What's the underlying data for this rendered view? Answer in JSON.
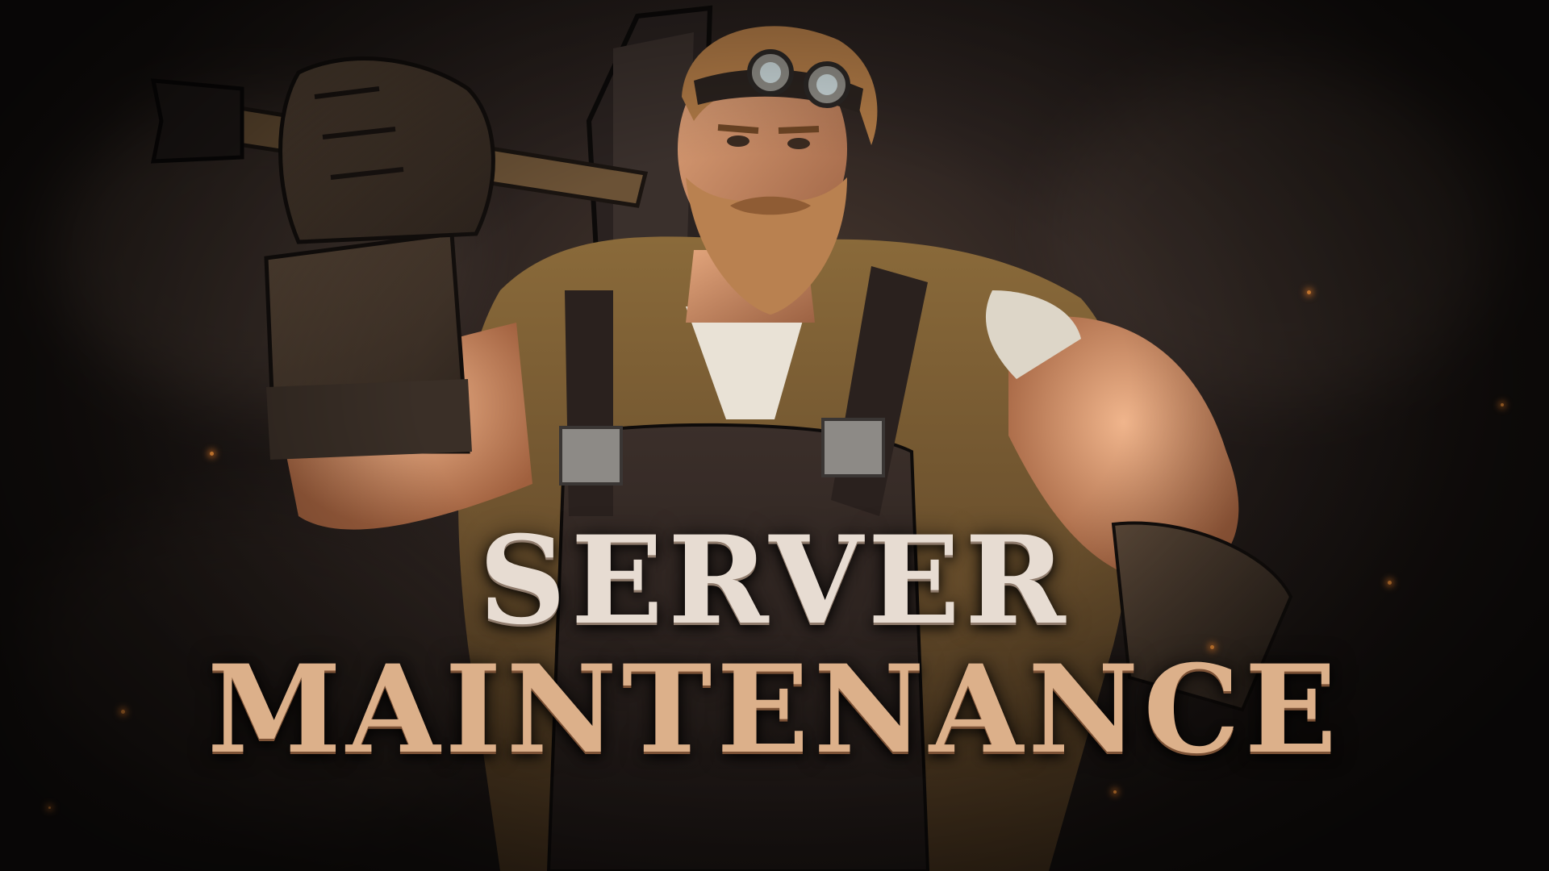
{
  "banner": {
    "title_line_1": "SERVER",
    "title_line_2": "MAINTENANCE"
  },
  "colors": {
    "background": "#1c1614",
    "title_line_1": "#e7dcd2",
    "title_line_2": "#dcb08a",
    "ember": "#ff9a3c"
  },
  "icons": {
    "character": "blacksmith-character-illustration",
    "hammer": "sledgehammer-icon"
  }
}
